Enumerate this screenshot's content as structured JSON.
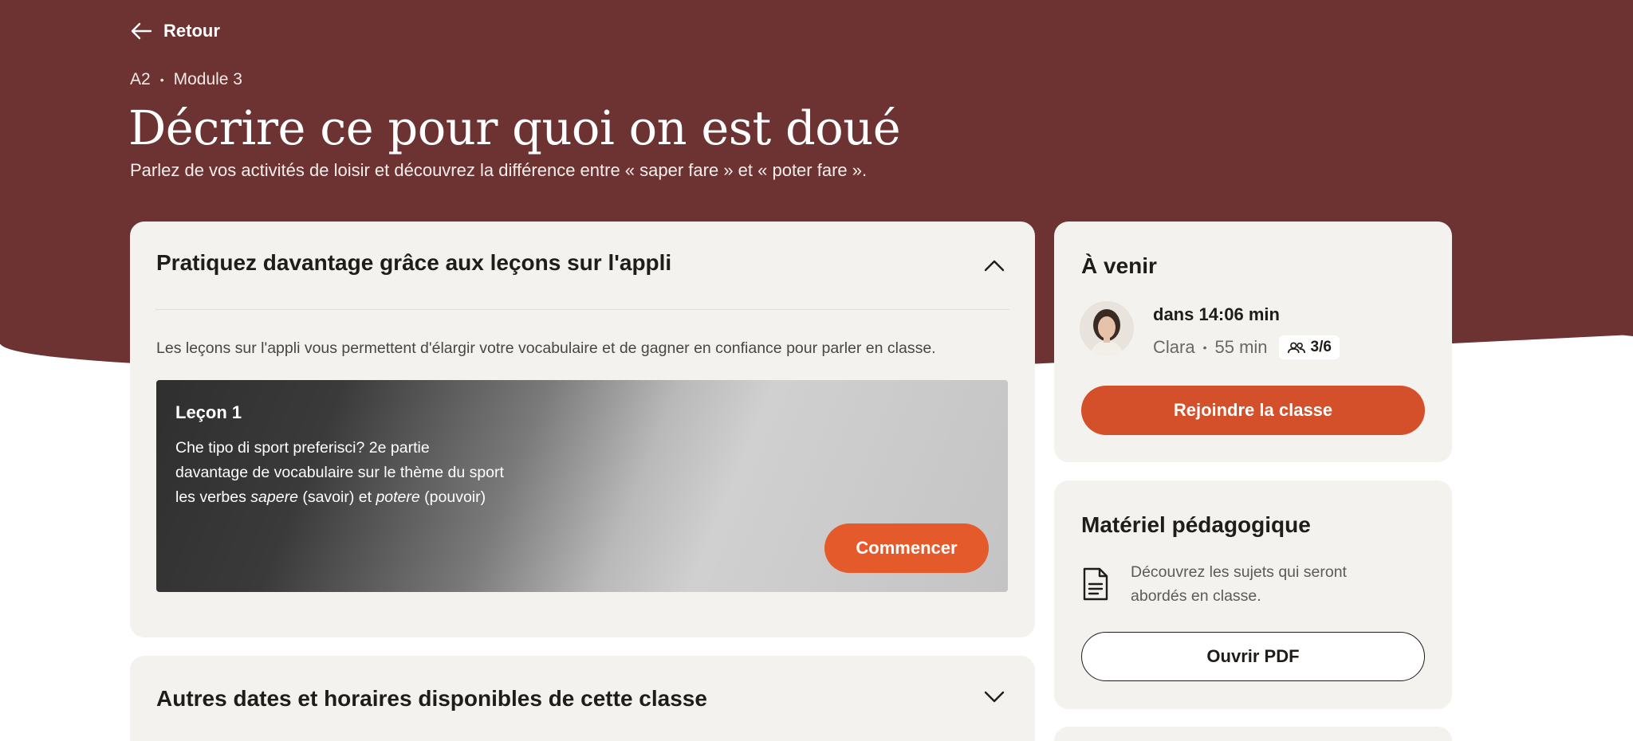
{
  "colors": {
    "hero_bg": "#6d3332",
    "card_bg": "#f3f2ee",
    "accent_orange": "#e55a2b",
    "join_button": "#d4502a"
  },
  "header": {
    "back_label": "Retour",
    "level": "A2",
    "module": "Module 3",
    "title": "Décrire ce pour quoi on est doué",
    "subtitle": "Parlez de vos activités de loisir et découvrez la différence entre « saper fare » et « poter fare »."
  },
  "practice": {
    "heading": "Pratiquez davantage grâce aux leçons sur l'appli",
    "intro": "Les leçons sur l'appli vous permettent d'élargir votre vocabulaire et de gagner en confiance pour parler en classe.",
    "lesson": {
      "title": "Leçon 1",
      "line1": "Che tipo di sport preferisci? 2e partie",
      "line2": "davantage de vocabulaire sur le thème du sport",
      "line3_prefix": "les verbes ",
      "line3_em1": "sapere",
      "line3_mid": " (savoir) et ",
      "line3_em2": "potere",
      "line3_suffix": " (pouvoir)",
      "start_label": "Commencer"
    }
  },
  "dates": {
    "heading": "Autres dates et horaires disponibles de cette classe"
  },
  "upcoming": {
    "heading": "À venir",
    "when": "dans 14:06 min",
    "teacher": "Clara",
    "duration": "55 min",
    "capacity": "3/6",
    "join_label": "Rejoindre la classe"
  },
  "material": {
    "heading": "Matériel pédagogique",
    "description": "Découvrez les sujets qui seront abordés en classe.",
    "pdf_label": "Ouvrir PDF"
  }
}
